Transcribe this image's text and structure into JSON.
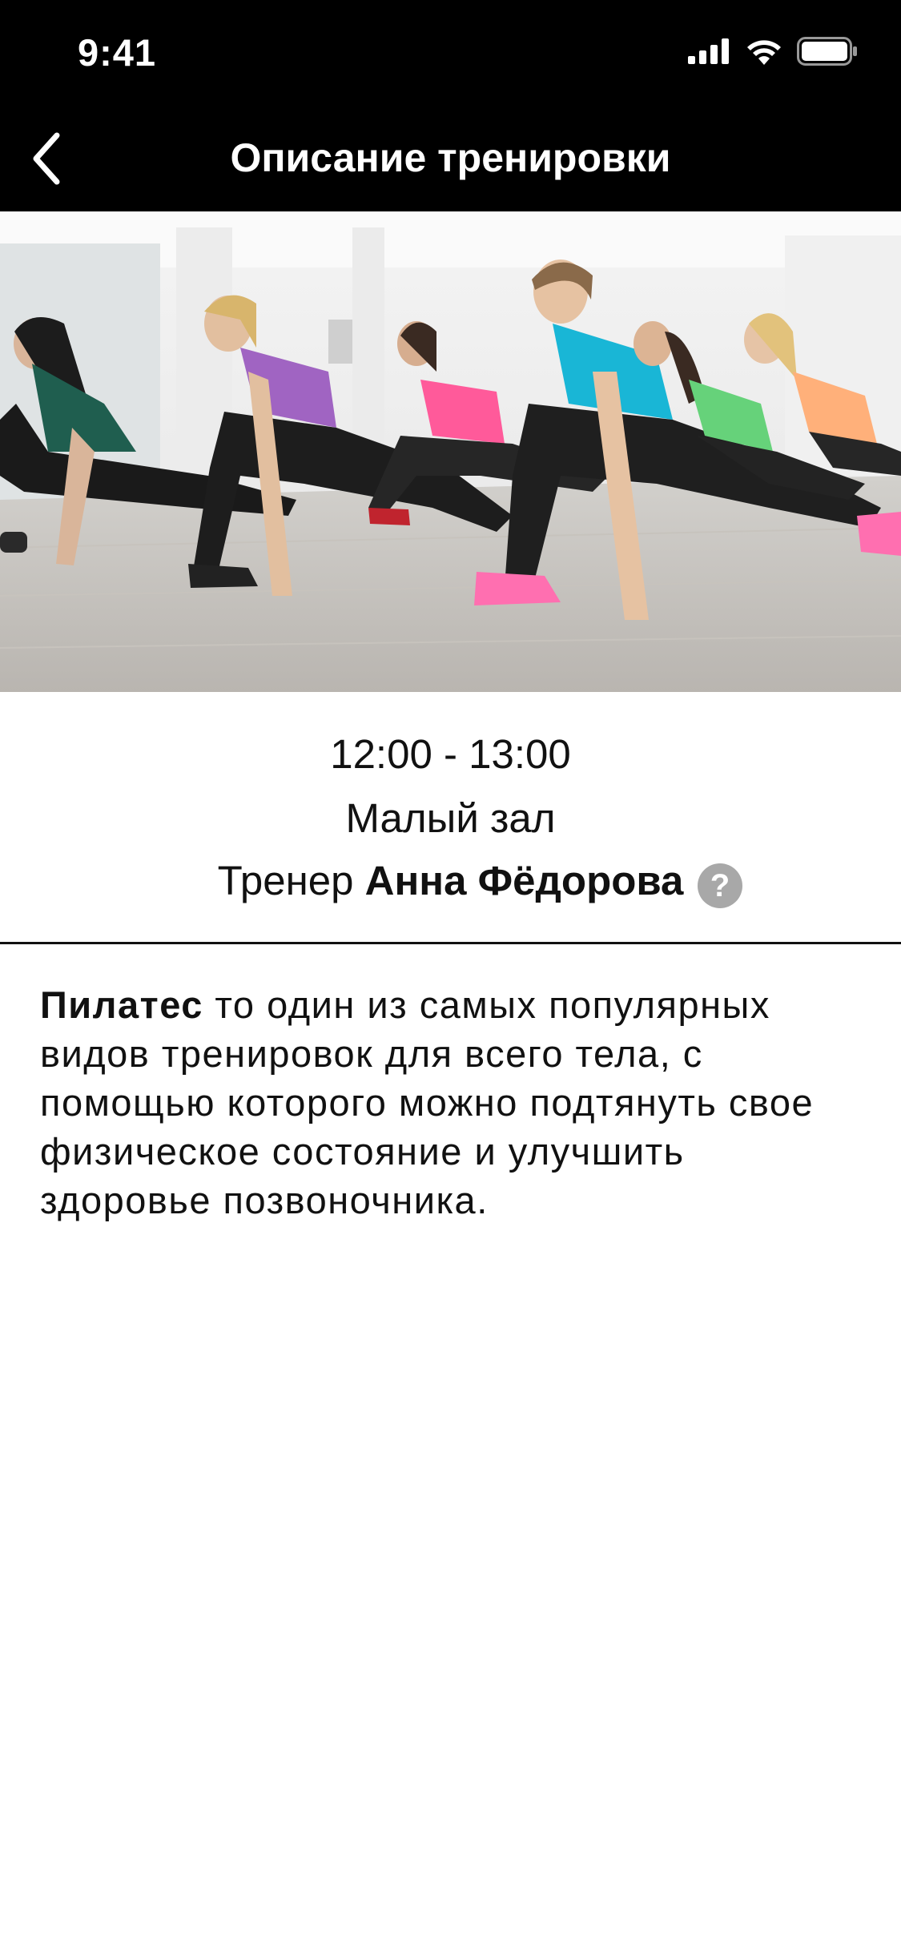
{
  "status_bar": {
    "time": "9:41",
    "icons": [
      "signal-icon",
      "wifi-icon",
      "battery-icon"
    ]
  },
  "nav": {
    "back_icon": "chevron-left-icon",
    "title": "Описание тренировки"
  },
  "hero": {
    "image": "group-fitness-class-lunge-stretch-photo"
  },
  "workout": {
    "time": "12:00 - 13:00",
    "hall": "Малый зал",
    "trainer_prefix": "Тренер",
    "trainer_name": "Анна Фёдорова",
    "help_label": "?"
  },
  "description": {
    "title": "Пилатес",
    "text": " то один из самых популярных видов тренировок для всего тела, с помощью  которого можно подтянуть свое физическое состояние и улучшить здоровье позвоночника."
  },
  "colors": {
    "header_bg": "#000000",
    "help_icon_bg": "#a8a8a8",
    "text": "#111111"
  }
}
